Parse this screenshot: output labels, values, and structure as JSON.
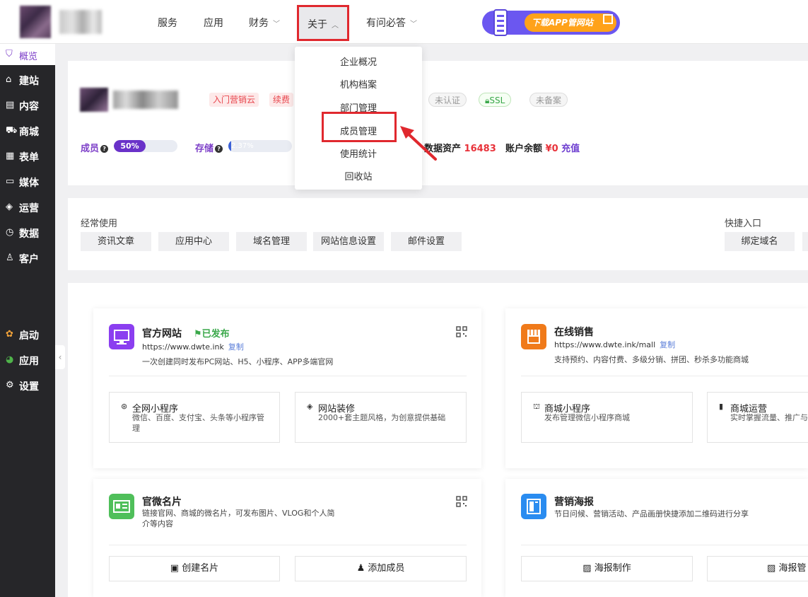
{
  "topnav": {
    "items": [
      {
        "label": "服务"
      },
      {
        "label": "应用"
      },
      {
        "label": "财务"
      },
      {
        "label": "关于"
      },
      {
        "label": "有问必答"
      }
    ],
    "app_banner": "下载APP管网站"
  },
  "sidebar": {
    "items": [
      {
        "label": "概览",
        "icon": "overview-icon"
      },
      {
        "label": "建站",
        "icon": "home-icon"
      },
      {
        "label": "内容",
        "icon": "document-icon"
      },
      {
        "label": "商城",
        "icon": "cart-icon"
      },
      {
        "label": "表单",
        "icon": "form-icon"
      },
      {
        "label": "媒体",
        "icon": "video-icon"
      },
      {
        "label": "运营",
        "icon": "tag-icon"
      },
      {
        "label": "数据",
        "icon": "clock-icon"
      },
      {
        "label": "客户",
        "icon": "user-icon"
      },
      {
        "label": "启动",
        "icon": "launch-icon"
      },
      {
        "label": "应用",
        "icon": "apps-icon"
      },
      {
        "label": "设置",
        "icon": "gear-icon"
      }
    ]
  },
  "account": {
    "tags": [
      "入门营销云",
      "续费",
      "未认证",
      "SSL",
      "未备案"
    ],
    "members_label": "成员",
    "members_percent": "50%",
    "storage_label": "存储",
    "storage_percent": "2.37%",
    "data_assets_label": "数据资产",
    "data_assets_value": "16483",
    "balance_label": "账户余额",
    "balance_value": "¥0",
    "recharge_label": "充值"
  },
  "dropdown": {
    "items": [
      "企业概况",
      "机构档案",
      "部门管理",
      "成员管理",
      "使用统计",
      "回收站"
    ]
  },
  "frequent": {
    "title": "经常使用",
    "buttons": [
      "资讯文章",
      "应用中心",
      "域名管理",
      "网站信息设置",
      "邮件设置"
    ],
    "quick_title": "快捷入口",
    "quick_buttons": [
      "绑定域名"
    ]
  },
  "tiles": {
    "website": {
      "title": "官方网站",
      "status": "已发布",
      "url": "https://www.dwte.ink",
      "copy": "复制",
      "desc": "一次创建同时发布PC网站、H5、小程序、APP多端官网",
      "sub1_title": "全网小程序",
      "sub1_desc": "微信、百度、支付宝、头条等小程序管理",
      "sub2_title": "网站装修",
      "sub2_desc": "2000+套主题风格，为创意提供基础"
    },
    "shop": {
      "title": "在线销售",
      "url": "https://www.dwte.ink/mall",
      "copy": "复制",
      "desc": "支持预约、内容付费、多级分销、拼团、秒杀多功能商城",
      "sub1_title": "商城小程序",
      "sub1_desc": "发布管理微信小程序商城",
      "sub2_title": "商城运营",
      "sub2_desc": "实时掌握流量、推广与"
    },
    "card": {
      "title": "官微名片",
      "desc": "链接官网、商城的微名片，可发布图片、VLOG和个人简介等内容",
      "btn1": "创建名片",
      "btn2": "添加成员"
    },
    "poster": {
      "title": "营销海报",
      "desc": "节日问候、营销活动、产品画册快捷添加二维码进行分享",
      "btn1": "海报制作",
      "btn2": "海报管"
    }
  },
  "colors": {
    "accent": "#7d3fc8",
    "highlight_border": "#e0282e",
    "sidebar_bg": "#262629"
  }
}
